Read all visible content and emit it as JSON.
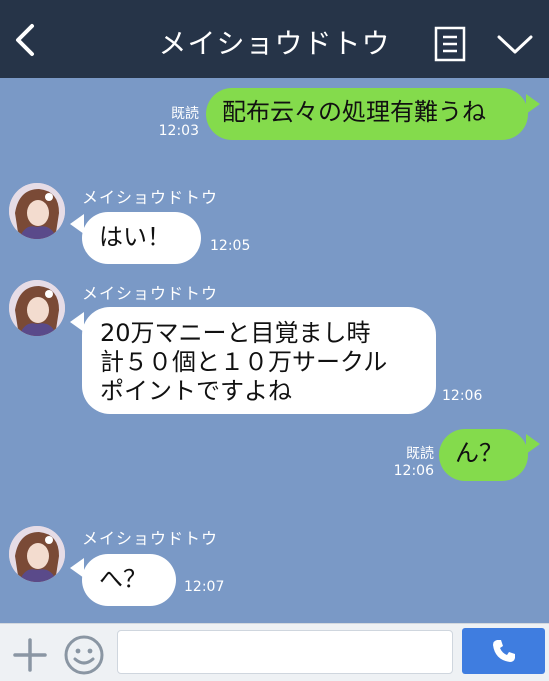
{
  "header": {
    "title": "メイショウドトウ",
    "back_icon": "chevron-left-icon",
    "menu_icon": "notes-icon",
    "collapse_icon": "chevron-down-icon"
  },
  "messages": [
    {
      "direction": "out",
      "read_label": "既読",
      "time": "12:03",
      "text": "配布云々の処理有難うね"
    },
    {
      "direction": "in",
      "sender": "メイショウドトウ",
      "time": "12:05",
      "text": "はい！"
    },
    {
      "direction": "in",
      "sender": "メイショウドトウ",
      "time": "12:06",
      "lines": [
        "20万マニーと目覚まし時",
        "計５０個と１０万サークル",
        "ポイントですよね"
      ]
    },
    {
      "direction": "out",
      "read_label": "既読",
      "time": "12:06",
      "text": "ん？"
    },
    {
      "direction": "in",
      "sender": "メイショウドトウ",
      "time": "12:07",
      "text": "へ？"
    }
  ],
  "footer": {
    "add_icon": "plus-icon",
    "emoji_icon": "smiley-icon",
    "message_input_value": "",
    "send_icon": "phone-icon"
  },
  "colors": {
    "header_bg": "#263448",
    "chat_bg": "#7a99c6",
    "outgoing_bubble": "#84db4c",
    "incoming_bubble": "#ffffff",
    "send_button": "#3f7de0"
  }
}
